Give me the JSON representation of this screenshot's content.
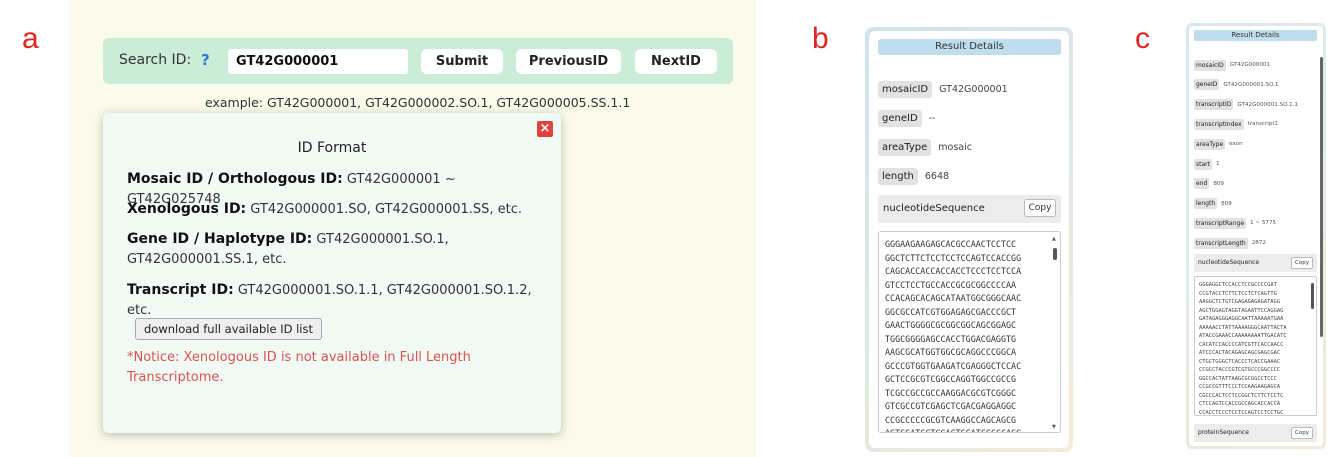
{
  "panel_labels": [
    "a",
    "b",
    "c"
  ],
  "panel_a": {
    "search_label": "Search ID:",
    "help_glyph": "?",
    "search_value": "GT42G000001",
    "buttons": {
      "submit": "Submit",
      "previous": "PreviousID",
      "next": "NextID"
    },
    "example": "example:  GT42G000001,  GT42G000002.SO.1,  GT42G000005.SS.1.1",
    "modal": {
      "close_glyph": "×",
      "title": "ID Format",
      "rows": [
        {
          "label": "Mosaic ID / Orthologous ID:",
          "value": " GT42G000001 ~ GT42G025748"
        },
        {
          "label": "Xenologous ID:",
          "value": " GT42G000001.SO, GT42G000001.SS, etc."
        },
        {
          "label": "Gene ID / Haplotype ID:",
          "value": " GT42G000001.SO.1, GT42G000001.SS.1, etc."
        },
        {
          "label": "Transcript ID:",
          "value": " GT42G000001.SO.1.1, GT42G000001.SO.1.2, etc."
        }
      ],
      "download_label": "download full available ID list",
      "notice": "*Notice: Xenologous ID is not available in Full Length Transcriptome."
    }
  },
  "panel_b": {
    "title": "Result Details",
    "fields": [
      {
        "key": "mosaicID",
        "value": "GT42G000001"
      },
      {
        "key": "geneID",
        "value": "--"
      },
      {
        "key": "areaType",
        "value": "mosaic"
      },
      {
        "key": "length",
        "value": "6648"
      }
    ],
    "sequence_label": "nucleotideSequence",
    "copy_label": "Copy",
    "sequence_lines": [
      "GGGAAGAAGAGCACGCCAACTCCTCC",
      "GGCTCTTCTCCTCCTCCAGTCCACCGG",
      "CAGCACCACCACCACCTCCCTCCTCCA",
      "GTCCTCCTGCCACCGCGCGGCCCCAA",
      "CCACAGCACAGCATAATGGCGGGCAAC",
      "GGCGCCATCGTGGAGAGCGACCCGCT",
      "GAACTGGGGCGCGGCGGCAGCGGAGC",
      "TGGCGGGGAGCCACCTGGACGAGGTG",
      "AAGCGCATGGTGGCGCAGGCCCGGCA",
      "GCCCGTGGTGAAGATCGAGGGCTCCAC",
      "GCTCCGCGTCGGCCAGGTGGCCGCCG",
      "TCGCCGCCGCCAAGGACGCGTCGGGC",
      "GTCGCCGTCGAGCTCGACGAGGAGGC",
      "CCGCCCCCGCGTCAAGGCCAGCAGCG",
      "AGTGGATCCTCGACTGCATCGCCCACG",
      "GCGGCGACATCTACGGCGTCACCTGGA"
    ]
  },
  "panel_c": {
    "title": "Result Details",
    "fields": [
      {
        "key": "mosaicID",
        "value": "GT42G000001"
      },
      {
        "key": "geneID",
        "value": "GT42G000001.SO.1"
      },
      {
        "key": "transcriptID",
        "value": "GT42G000001.SO.1.1"
      },
      {
        "key": "transcriptIndex",
        "value": "transcript1"
      },
      {
        "key": "areaType",
        "value": "exon"
      },
      {
        "key": "start",
        "value": "1"
      },
      {
        "key": "end",
        "value": "809"
      },
      {
        "key": "length",
        "value": "809"
      },
      {
        "key": "transcriptRange",
        "value": "1 ~ 5775"
      },
      {
        "key": "transcriptLength",
        "value": "2872"
      }
    ],
    "sequence_label": "nucleotideSequence",
    "protein_label": "proteinSequence",
    "copy_label": "Copy",
    "sequence_lines": [
      "GGGAGGCTCCACCTCCGCCCCGAT",
      "CCGTACCTCTTCTCCTCTCAGTTG",
      "AAGGCTCTGTCGAGAGAGAGATAGG",
      "AGCTGGAGTAGGTAGAATTCCAGGAG",
      "GATAGAGGGAGGCAATTAAAAATGAA",
      "AAAAACCTATTAAAAGGGCAATTACTA",
      "ATACCGAAACCAAAAAAAATTGACATC",
      "CACATCCACCCCATCGTTCACCAACC",
      "ATCCCACTACAGAGCAGCGAGCGAC",
      "CTGCTGGGCTCACCCTCACCGAAAC",
      "CCGCCTACCCGTCGTGCCCGGCCCC",
      "GGCCACTATTAAGCGCGGCCTCCC",
      "CCGCCGTTTCCCTCCAAGAAGAGCA",
      "CGCCCACTCCTCCGGCTCTTCTCCTC",
      "CTCCAGTCCACCGCCAGCACCACCA",
      "CCACCTCCCTCCTCCAGTCCTCCTGC"
    ]
  }
}
